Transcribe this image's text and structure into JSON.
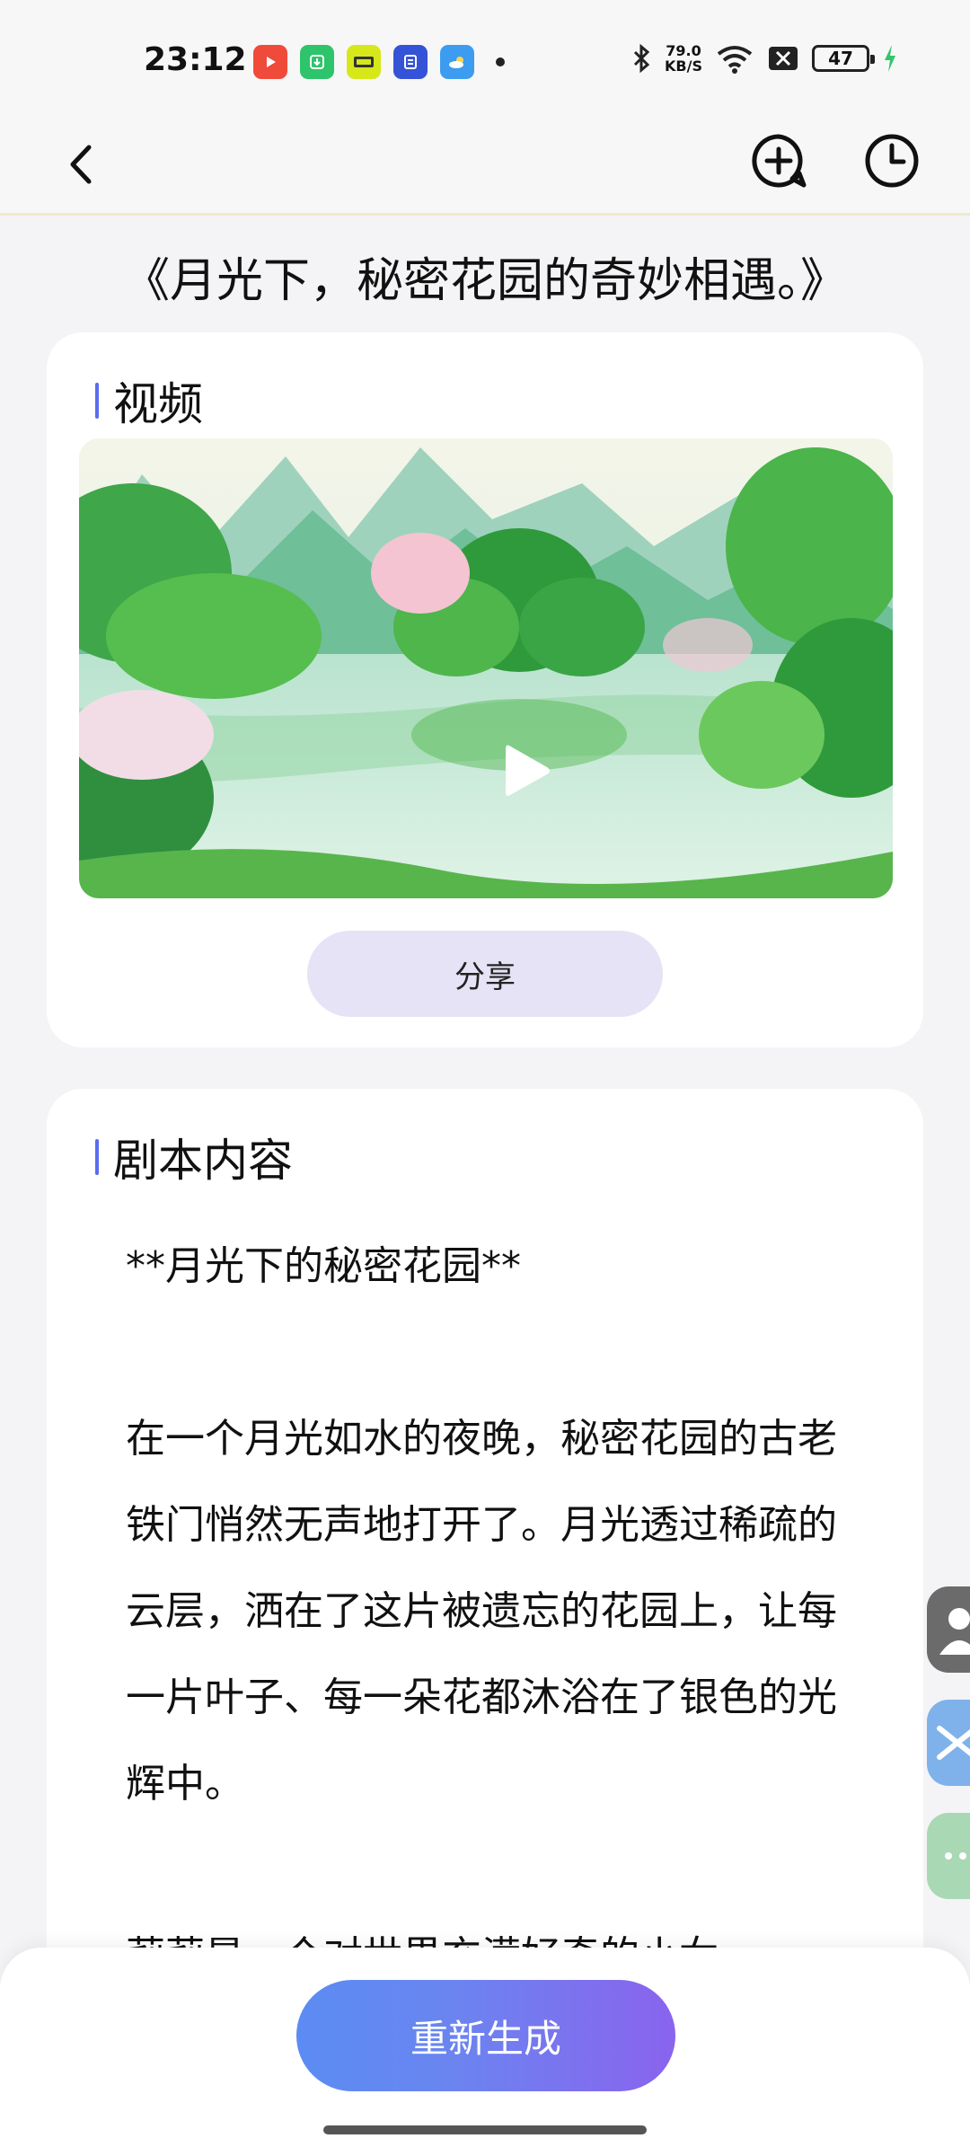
{
  "status_bar": {
    "time": "23:12",
    "net_speed_value": "79.0",
    "net_speed_unit": "KB/S",
    "battery": "47",
    "icons": [
      "video-app-icon",
      "store-app-icon",
      "shop-app-icon",
      "tieba-app-icon",
      "weather-app-icon",
      "bluetooth-icon",
      "wifi-icon",
      "sim-off-icon",
      "charging-icon"
    ]
  },
  "nav": {
    "back_icon": "chevron-left-icon",
    "add_icon": "add-chat-icon",
    "history_icon": "clock-icon"
  },
  "page": {
    "title": "《月光下，秘密花园的奇妙相遇。》"
  },
  "video_card": {
    "section_title": "视频",
    "share_label": "分享",
    "play_icon": "play-icon"
  },
  "script_card": {
    "section_title": "剧本内容",
    "heading": "**月光下的秘密花园**",
    "paragraphs": [
      "在一个月光如水的夜晚，秘密花园的古老铁门悄然无声地打开了。月光透过稀疏的云层，洒在了这片被遗忘的花园上，让每一片叶子、每一朵花都沐浴在了银色的光辉中。",
      "莉莉是一个对世界充满好奇的小女"
    ]
  },
  "bottom": {
    "regenerate_label": "重新生成"
  },
  "colors": {
    "accent": "#5a6cf0",
    "share_bg": "#e6e3f6",
    "regen_gradient_start": "#5b8cf3",
    "regen_gradient_end": "#8a63ee"
  }
}
